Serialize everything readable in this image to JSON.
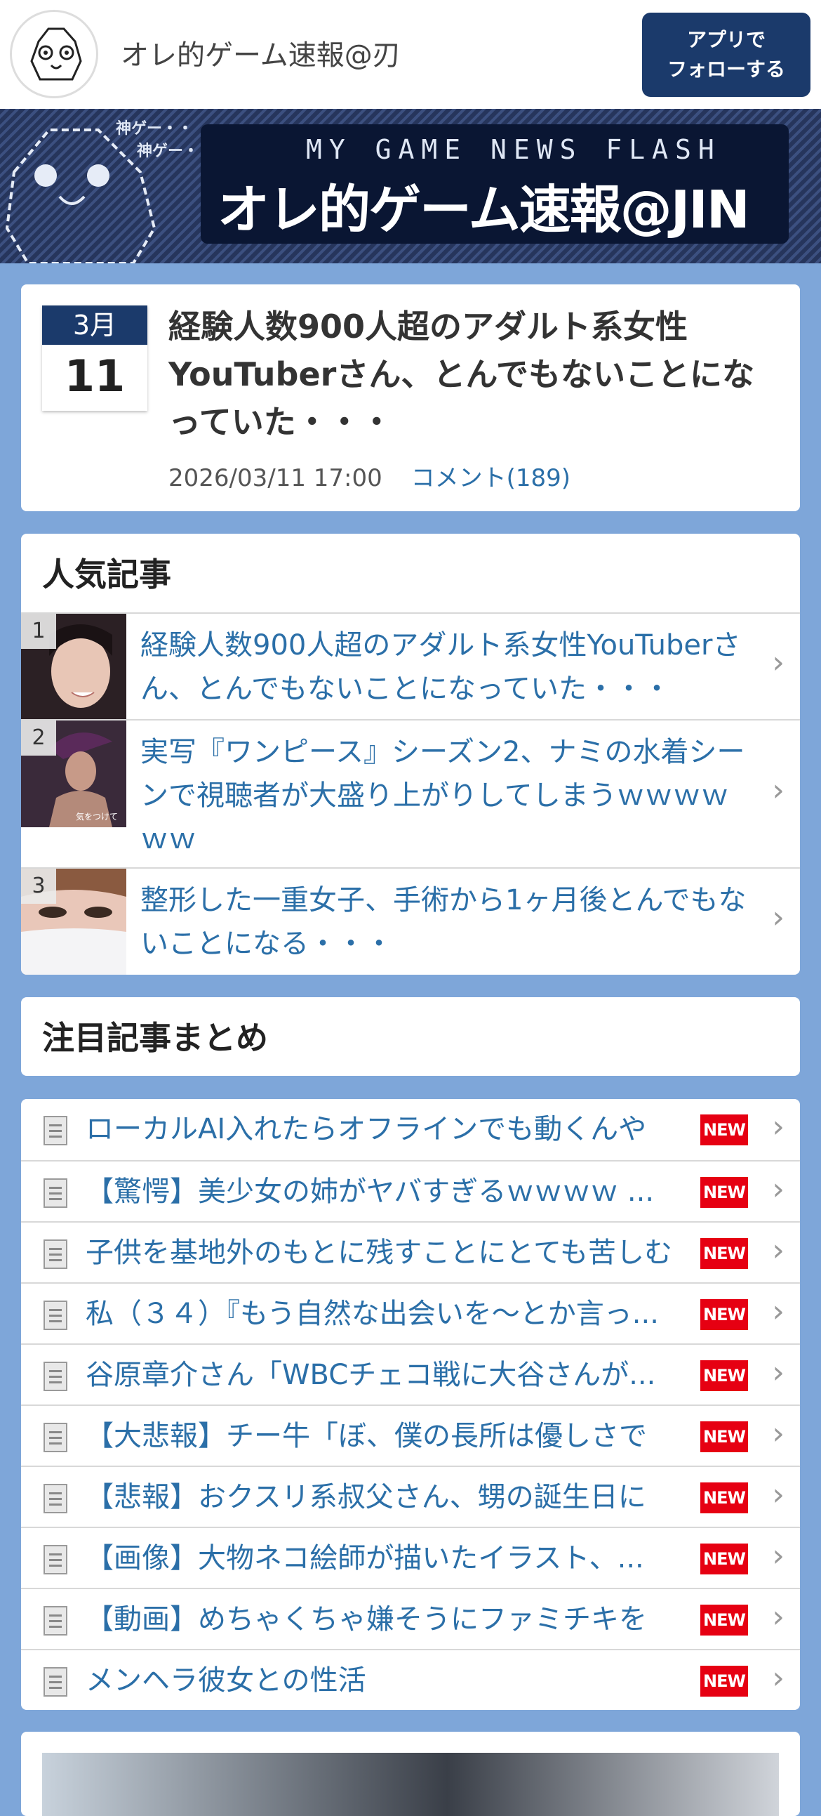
{
  "header": {
    "site_name": "オレ的ゲーム速報@刃",
    "follow_button": "アプリで\nフォローする"
  },
  "banner": {
    "subtitle": "MY GAME NEWS FLASH",
    "title": "オレ的ゲーム速報@JIN",
    "small_1": "神ゲー・・",
    "small_2": "神ゲー・・"
  },
  "featured": {
    "month": "3月",
    "day": "11",
    "title": "経験人数900人超のアダルト系女性YouTuberさん、とんでもないことになっていた・・・",
    "datetime": "2026/03/11 17:00",
    "comments": "コメント(189)"
  },
  "popular": {
    "heading": "人気記事",
    "items": [
      {
        "rank": "1",
        "title": "経験人数900人超のアダルト系女性YouTuberさん、とんでもないことになっていた・・・"
      },
      {
        "rank": "2",
        "title": "実写『ワンピース』シーズン2、ナミの水着シーンで視聴者が大盛り上がりしてしまうｗｗｗｗｗｗ",
        "thumb_caption": "気をつけて"
      },
      {
        "rank": "3",
        "title": "整形した一重女子、手術から1ヶ月後とんでもないことになる・・・"
      }
    ]
  },
  "pickup": {
    "heading": "注目記事まとめ",
    "new_label": "NEW",
    "items": [
      {
        "title": "ローカルAI入れたらオフラインでも動くんや"
      },
      {
        "title": "【驚愕】美少女の姉がヤバすぎるｗｗｗｗ ..."
      },
      {
        "title": "子供を基地外のもとに残すことにとても苦しむ"
      },
      {
        "title": "私（３４）『もう自然な出会いを～とか言っ..."
      },
      {
        "title": "谷原章介さん「WBCチェコ戦に大谷さんが..."
      },
      {
        "title": "【大悲報】チー牛「ぼ、僕の長所は優しさで"
      },
      {
        "title": "【悲報】おクスリ系叔父さん、甥の誕生日に"
      },
      {
        "title": "【画像】大物ネコ絵師が描いたイラスト、..."
      },
      {
        "title": "【動画】めちゃくちゃ嫌そうにファミチキを"
      },
      {
        "title": "メンヘラ彼女との性活"
      }
    ]
  }
}
